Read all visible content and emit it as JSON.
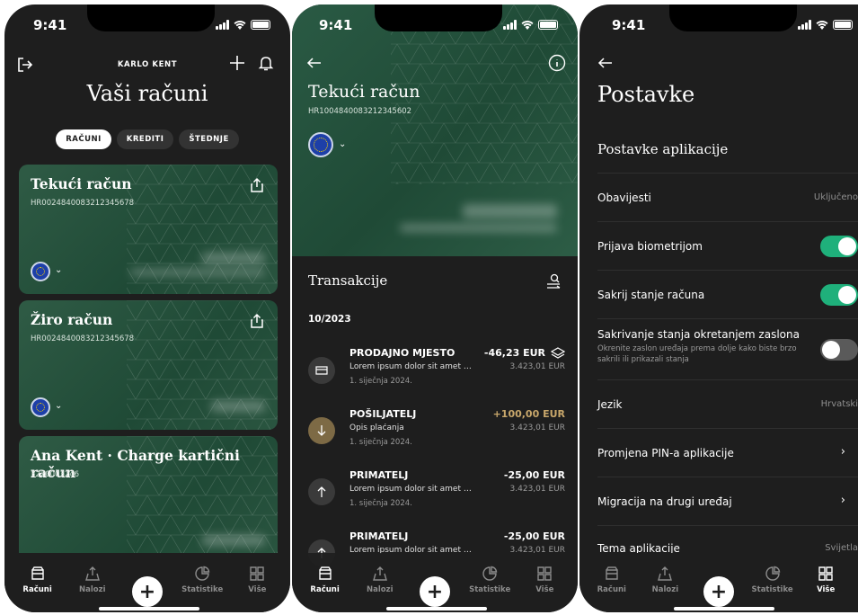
{
  "status": {
    "time": "9:41"
  },
  "screen1": {
    "user_name": "KARLO KENT",
    "title": "Vaši računi",
    "segments": [
      "RAČUNI",
      "KREDITI",
      "ŠTEDNJE"
    ],
    "active_segment": 0,
    "cards": [
      {
        "title": "Tekući račun",
        "iban": "HR0024840083212345678"
      },
      {
        "title": "Žiro račun",
        "iban": "HR0024840083212345678"
      },
      {
        "title": "Ana Kent · Charge kartični račun",
        "iban": "3220003246"
      }
    ]
  },
  "screen2": {
    "title": "Tekući račun",
    "iban": "HR1004840083212345602",
    "section_title": "Transakcije",
    "month": "10/2023",
    "transactions": [
      {
        "name": "PRODAJNO MJESTO",
        "desc": "Lorem ipsum dolor sit amet consectetur",
        "date": "1. siječnja 2024.",
        "amount": "-46,23 EUR",
        "balance": "3.423,01 EUR",
        "icon": "card-icon",
        "positive": false
      },
      {
        "name": "POŠILJATELJ",
        "desc": "Opis plaćanja",
        "date": "1. siječnja 2024.",
        "amount": "+100,00 EUR",
        "balance": "3.423,01 EUR",
        "icon": "arrow-down-icon",
        "positive": true
      },
      {
        "name": "PRIMATELJ",
        "desc": "Lorem ipsum dolor sit amet consectetur",
        "date": "1. siječnja 2024.",
        "amount": "-25,00 EUR",
        "balance": "3.423,01 EUR",
        "icon": "arrow-up-icon",
        "positive": false
      },
      {
        "name": "PRIMATELJ",
        "desc": "Lorem ipsum dolor sit amet consectetur",
        "date": "",
        "amount": "-25,00 EUR",
        "balance": "3.423,01 EUR",
        "icon": "arrow-up-icon",
        "positive": false
      }
    ]
  },
  "screen3": {
    "title": "Postavke",
    "section_title": "Postavke aplikacije",
    "rows": [
      {
        "label": "Obavijesti",
        "value": "Uključeno",
        "type": "value"
      },
      {
        "label": "Prijava biometrijom",
        "type": "toggle",
        "on": true
      },
      {
        "label": "Sakrij stanje računa",
        "type": "toggle",
        "on": true
      },
      {
        "label": "Sakrivanje stanja okretanjem zaslona",
        "sub": "Okrenite zaslon uređaja prema dolje kako biste brzo sakrili ili prikazali stanja",
        "type": "toggle",
        "on": false
      },
      {
        "label": "Jezik",
        "value": "Hrvatski",
        "type": "value"
      },
      {
        "label": "Promjena PIN-a aplikacije",
        "type": "chevron"
      },
      {
        "label": "Migracija na drugi uređaj",
        "type": "chevron"
      },
      {
        "label": "Tema aplikacije",
        "value": "Svijetla",
        "type": "value"
      }
    ]
  },
  "tabbar": {
    "items": [
      "Računi",
      "Nalozi",
      "",
      "Statistike",
      "Više"
    ],
    "fab": "+"
  },
  "colors": {
    "background": "#1e1e1e",
    "card_green": "#2a5540",
    "accent_green": "#1fb07b",
    "incoming": "#c8a76b"
  }
}
